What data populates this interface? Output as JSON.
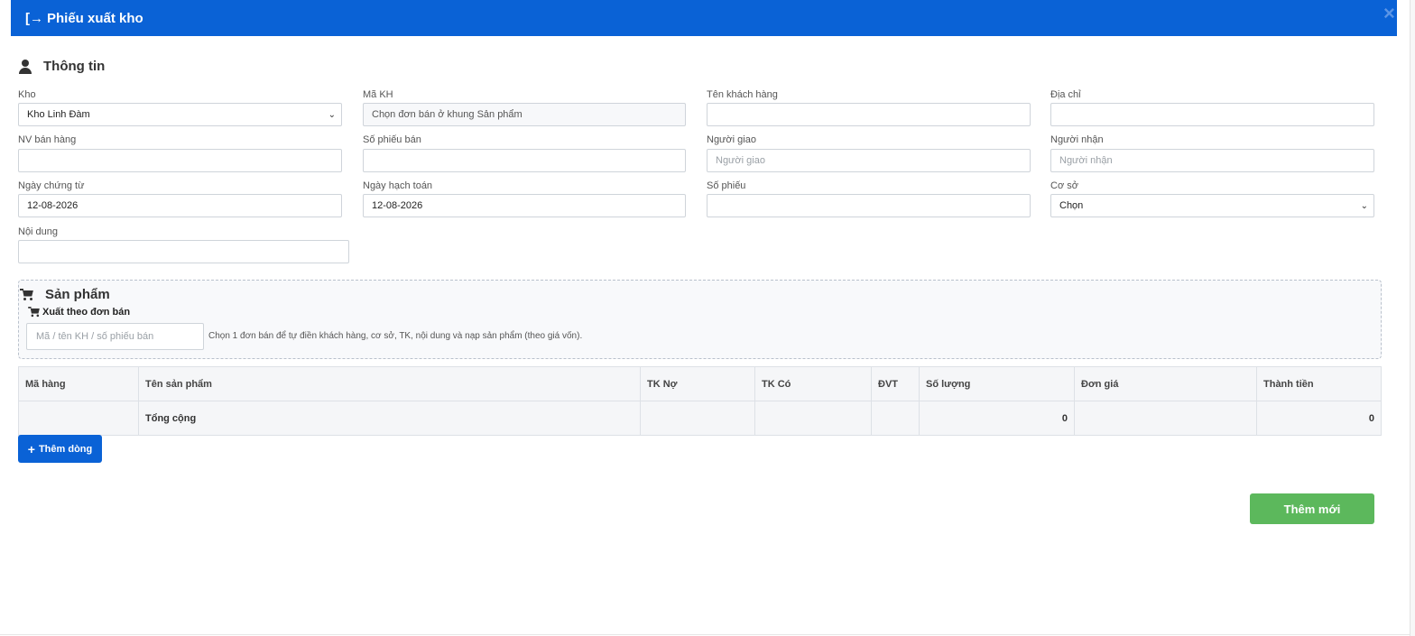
{
  "header": {
    "title": "Phiếu xuất kho",
    "icon": "sign-out-icon",
    "close": "×",
    "color": "#0a62d6"
  },
  "info": {
    "title": "Thông tin",
    "fields": {
      "kho": {
        "label": "Kho",
        "value": "Kho Linh Đàm"
      },
      "ma_kh": {
        "label": "Mã KH",
        "value": "Chọn đơn bán ở khung Sản phẩm"
      },
      "ten_kh": {
        "label": "Tên khách hàng",
        "value": ""
      },
      "dia_chi": {
        "label": "Địa chỉ",
        "value": ""
      },
      "nv_ban_hang": {
        "label": "NV bán hàng",
        "value": ""
      },
      "so_phieu_ban": {
        "label": "Số phiếu bán",
        "value": ""
      },
      "nguoi_giao": {
        "label": "Người giao",
        "value": "",
        "placeholder": "Người giao"
      },
      "nguoi_nhan": {
        "label": "Người nhận",
        "value": "",
        "placeholder": "Người nhận"
      },
      "ngay_chung_tu": {
        "label": "Ngày chứng từ",
        "value": "12-08-2026"
      },
      "ngay_hach_toan": {
        "label": "Ngày hạch toán",
        "value": "12-08-2026"
      },
      "so_phieu": {
        "label": "Số phiếu",
        "value": ""
      },
      "co_so": {
        "label": "Cơ sở",
        "value": "Chọn"
      },
      "noi_dung": {
        "label": "Nội dung",
        "value": ""
      }
    }
  },
  "products": {
    "title": "Sản phẩm",
    "subtitle": "Xuất theo đơn bán",
    "search_placeholder": "Mã / tên KH / số phiếu bán",
    "hint": "Chọn 1 đơn bán để tự điền khách hàng, cơ sở, TK, nội dung và nạp sản phẩm (theo giá vốn)."
  },
  "table": {
    "columns": [
      "Mã hàng",
      "Tên sản phẩm",
      "TK Nợ",
      "TK Có",
      "ĐVT",
      "Số lượng",
      "Đơn giá",
      "Thành tiền"
    ],
    "total_label": "Tổng cộng",
    "total_quantity": "0",
    "total_amount": "0"
  },
  "buttons": {
    "add_row": "Thêm dòng",
    "submit": "Thêm mới"
  }
}
